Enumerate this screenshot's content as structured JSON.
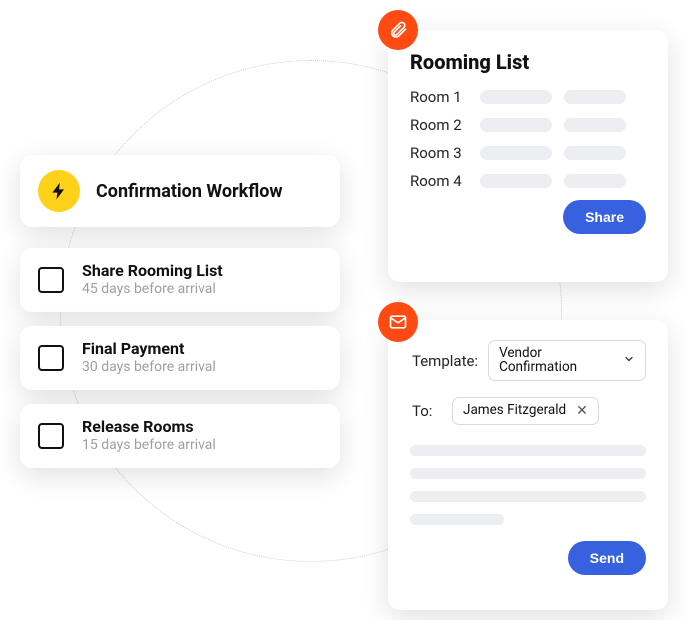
{
  "workflow": {
    "title": "Confirmation Workflow"
  },
  "tasks": [
    {
      "title": "Share Rooming List",
      "subtitle": "45 days before arrival"
    },
    {
      "title": "Final Payment",
      "subtitle": "30 days before arrival"
    },
    {
      "title": "Release Rooms",
      "subtitle": "15 days before arrival"
    }
  ],
  "rooming": {
    "title": "Rooming List",
    "rows": [
      "Room 1",
      "Room 2",
      "Room 3",
      "Room 4"
    ],
    "share_label": "Share"
  },
  "composer": {
    "template_label": "Template:",
    "template_value": "Vendor Confirmation",
    "to_label": "To:",
    "to_value": "James Fitzgerald",
    "send_label": "Send"
  }
}
